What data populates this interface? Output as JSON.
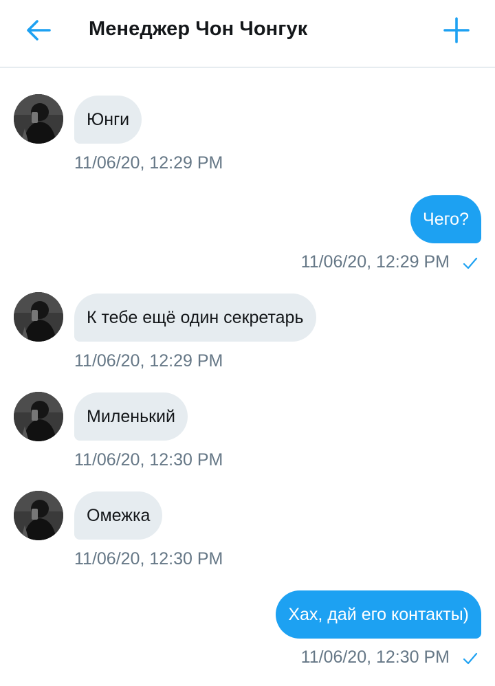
{
  "header": {
    "title": "Менеджер Чон Чонгук",
    "back_icon": "arrow-left-icon",
    "new_icon": "plus-icon",
    "accent_color": "#1da1f2"
  },
  "messages": [
    {
      "direction": "incoming",
      "text": "Юнги",
      "time": "11/06/20, 12:29 PM"
    },
    {
      "direction": "outgoing",
      "text": "Чего?",
      "time": "11/06/20, 12:29 PM",
      "status_icon": "checkmark-icon"
    },
    {
      "direction": "incoming",
      "text": "К тебе ещё один секретарь",
      "time": "11/06/20, 12:29 PM"
    },
    {
      "direction": "incoming",
      "text": "Миленький",
      "time": "11/06/20, 12:30 PM"
    },
    {
      "direction": "incoming",
      "text": "Омежка",
      "time": "11/06/20, 12:30 PM"
    },
    {
      "direction": "outgoing",
      "text": "Хах, дай его контакты)",
      "time": "11/06/20, 12:30 PM",
      "status_icon": "checkmark-icon"
    }
  ],
  "colors": {
    "incoming_bubble": "#e6ecf0",
    "outgoing_bubble": "#1da1f2",
    "timestamp": "#657786"
  }
}
